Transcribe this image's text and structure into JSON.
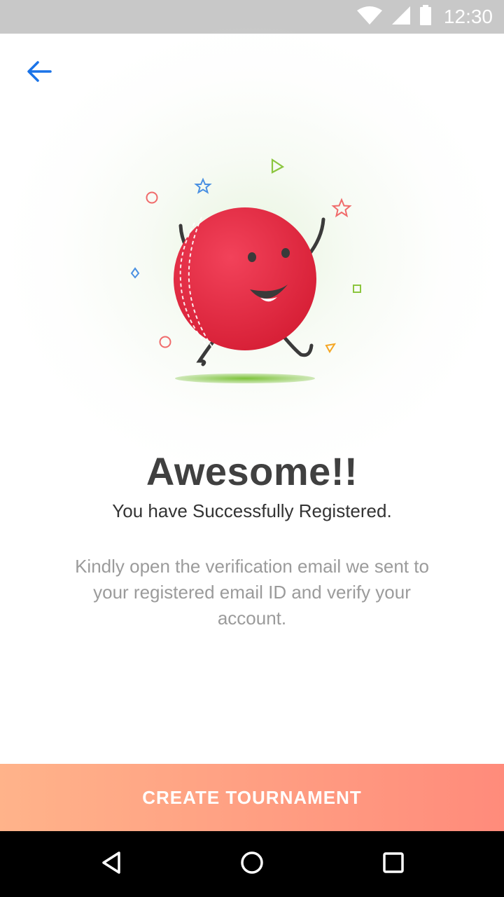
{
  "status_bar": {
    "time": "12:30",
    "icons": [
      "wifi-icon",
      "signal-icon",
      "battery-icon"
    ]
  },
  "header": {
    "back_icon": "arrow-left-icon"
  },
  "illustration": {
    "name": "cricket-ball-mascot",
    "accent_colors": [
      "#e8253d",
      "#8cc63f",
      "#4a90e2",
      "#ff6b6b",
      "#f5a623"
    ]
  },
  "content": {
    "title": "Awesome!!",
    "subtitle": "You have Successfully Registered.",
    "message": "Kindly open the verification email we sent to your registered email ID and verify your account."
  },
  "cta": {
    "label": "CREATE TOURNAMENT",
    "gradient_start": "#ffb38a",
    "gradient_end": "#ff8b7b"
  },
  "nav_bar": {
    "back": "nav-back-icon",
    "home": "nav-home-icon",
    "recents": "nav-recents-icon"
  }
}
